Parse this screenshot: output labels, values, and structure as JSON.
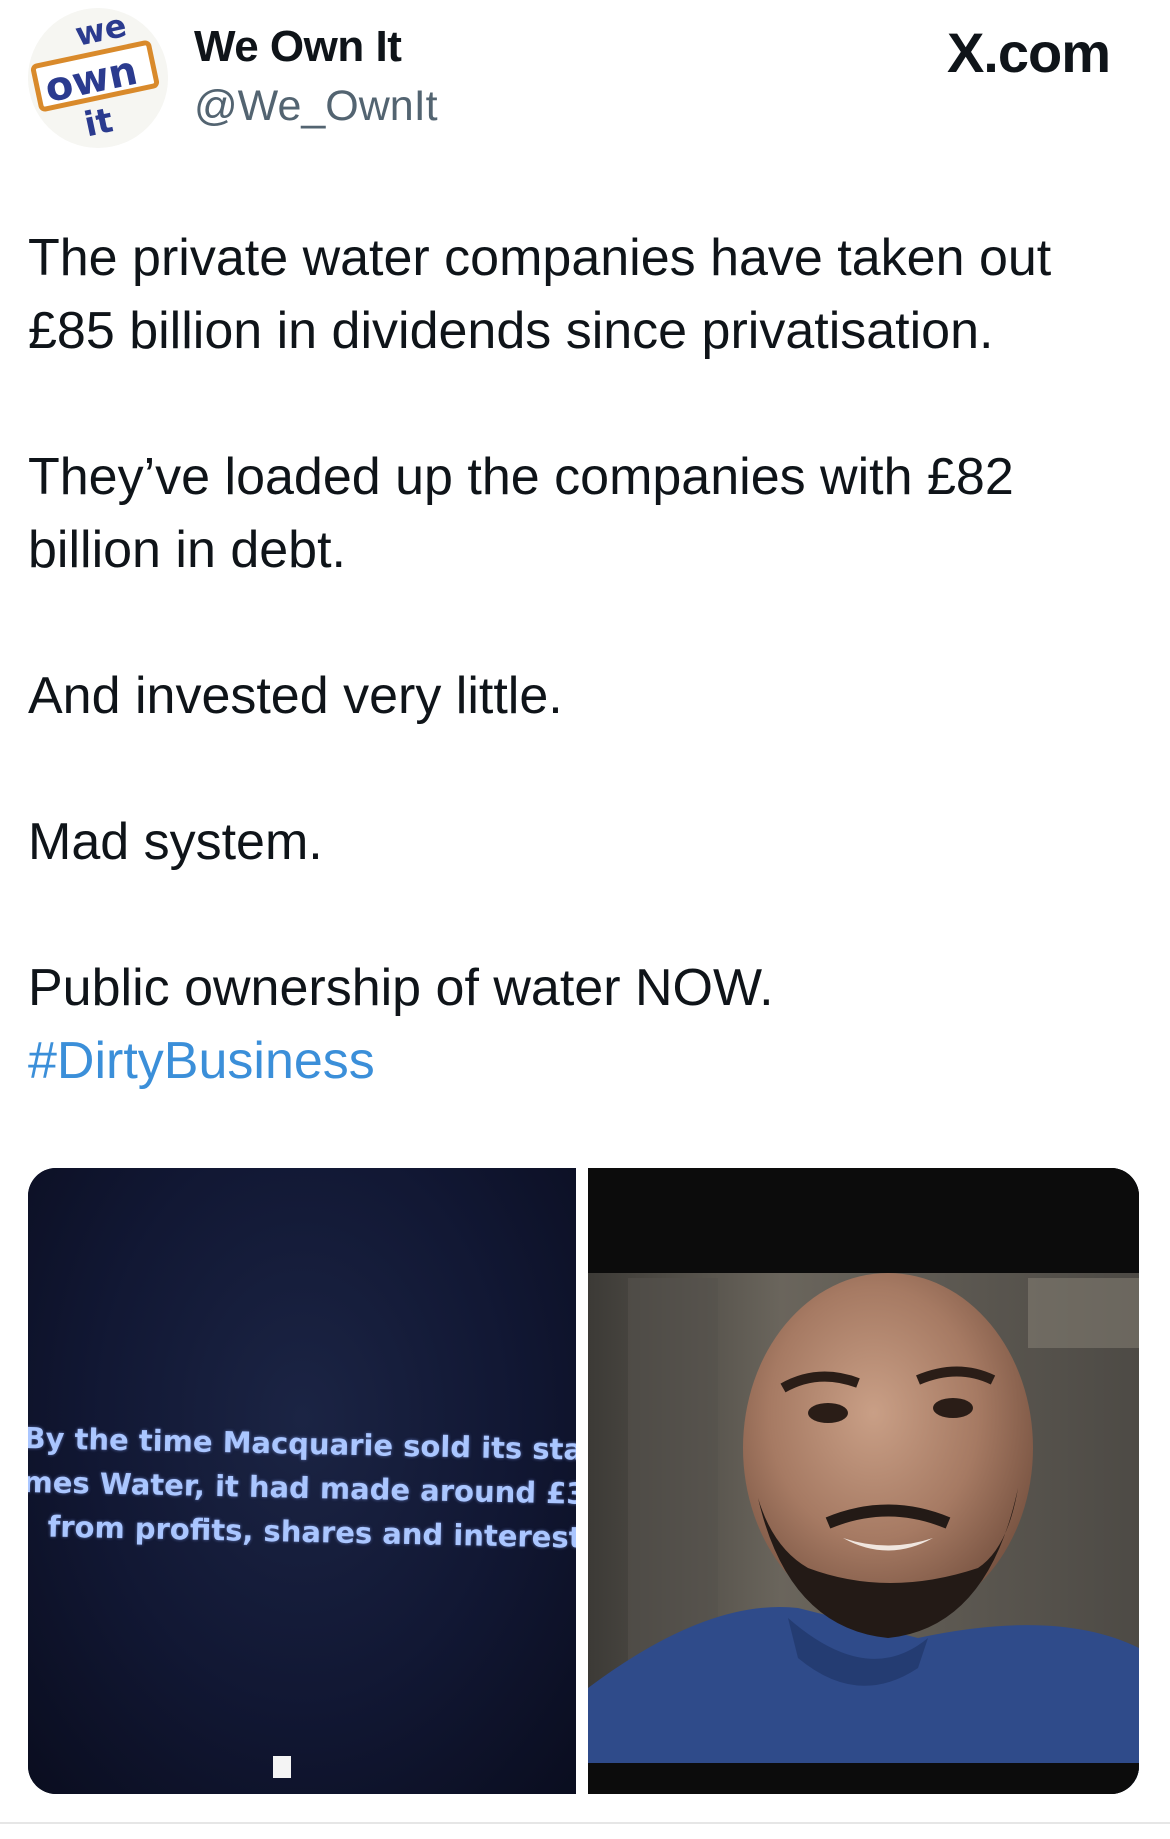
{
  "author": {
    "display_name": "We Own It",
    "handle": "@We_OwnIt",
    "avatar_logo_text": [
      "we",
      "own",
      "it"
    ]
  },
  "platform": {
    "label": "X.com"
  },
  "tweet": {
    "paragraphs": [
      "The private water companies have taken out £85 billion in dividends since privatisation.",
      "They’ve loaded up the companies with £82 billion in debt.",
      "And invested very little.",
      "Mad system.",
      "Public ownership of water NOW."
    ],
    "hashtag": "#DirtyBusiness"
  },
  "media": {
    "left_caption": [
      "By the time Macquarie sold its stake",
      "mes Water, it had made around £3",
      "from profits, shares and interest"
    ]
  },
  "colors": {
    "link": "#3b8fd9",
    "text": "#0f1419",
    "secondary": "#536471",
    "logo_orange": "#d98a2b",
    "logo_blue": "#2b3b8f"
  }
}
